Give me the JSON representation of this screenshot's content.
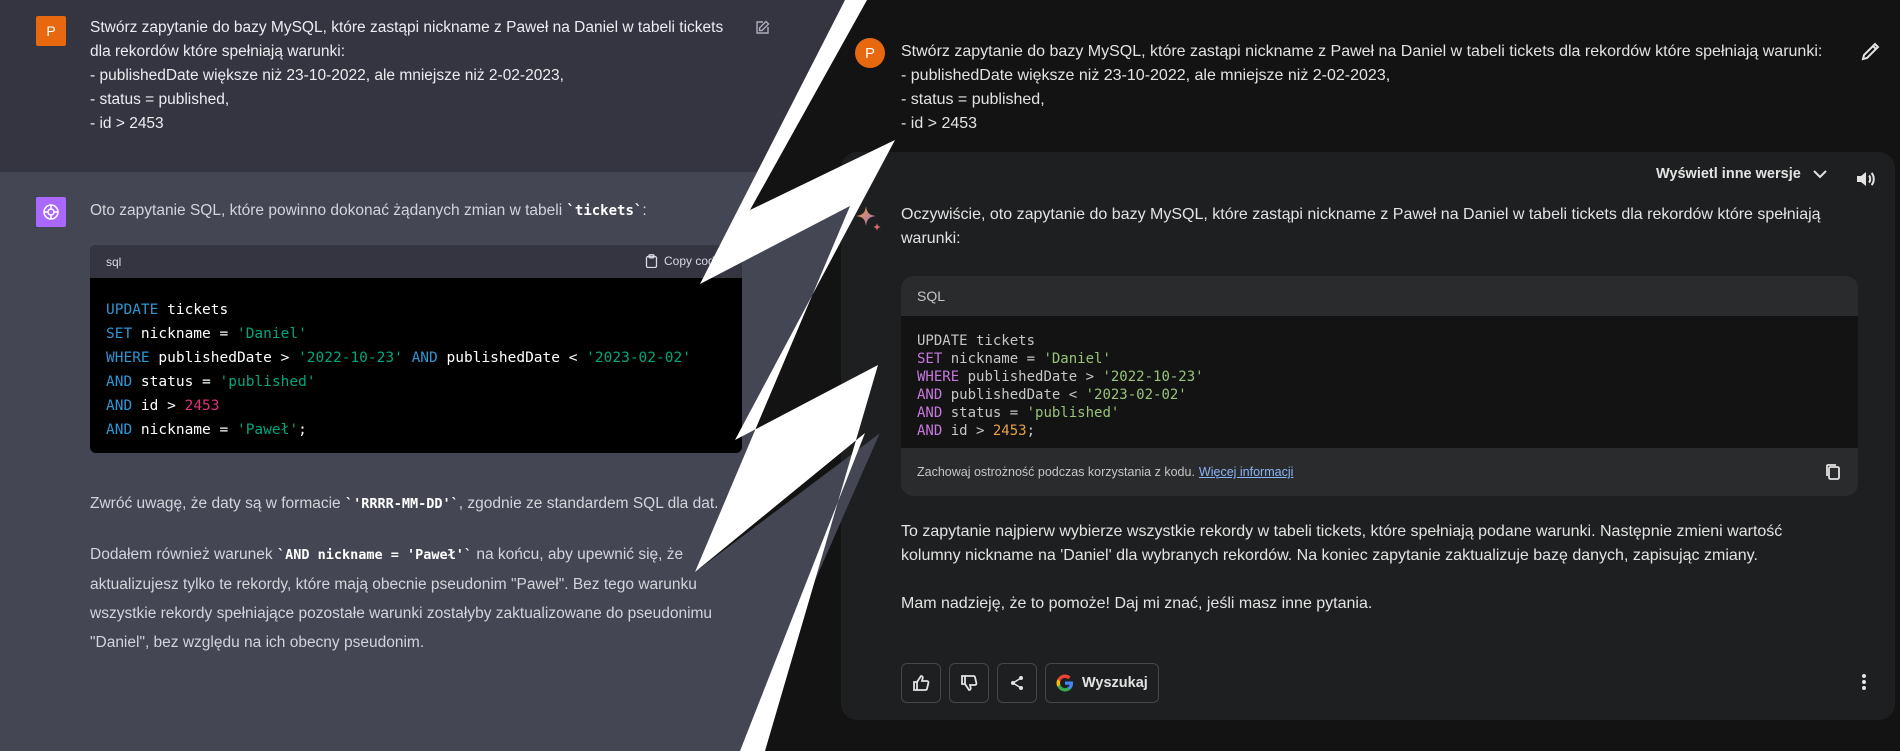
{
  "left": {
    "user": {
      "avatar_letter": "P",
      "line1": "Stwórz zapytanie do bazy MySQL, które zastąpi nickname z Paweł na Daniel w tabeli tickets",
      "line2": "dla rekordów które spełniają warunki:",
      "line3": "- publishedDate większe niż 23-10-2022, ale mniejsze niż 2-02-2023,",
      "line4": "- status = published,",
      "line5": "- id > 2453"
    },
    "assistant": {
      "intro_before": "Oto zapytanie SQL, które powinno dokonać żądanych zmian w tabeli ",
      "intro_code": "`tickets`",
      "intro_after": ":",
      "code_lang": "sql",
      "copy_label": "Copy code",
      "code": {
        "l1_k": "UPDATE",
        "l1_t": " tickets",
        "l2_k": "SET",
        "l2_t": " nickname = ",
        "l2_s": "'Daniel'",
        "l3_k": "WHERE",
        "l3_t1": " publishedDate > ",
        "l3_s1": "'2022-10-23'",
        "l3_k2": "AND",
        "l3_t2": " publishedDate < ",
        "l3_s2": "'2023-02-02'",
        "l4_k": "AND",
        "l4_t": " status = ",
        "l4_s": "'published'",
        "l5_k": "AND",
        "l5_t": " id > ",
        "l5_n": "2453",
        "l6_k": "AND",
        "l6_t": " nickname = ",
        "l6_s": "'Paweł'",
        "l6_end": ";"
      },
      "p1_before": "Zwróć uwagę, że daty są w formacie ",
      "p1_code": "`'RRRR-MM-DD'`",
      "p1_after": ", zgodnie ze standardem SQL dla dat.",
      "p2_before": "Dodałem również warunek ",
      "p2_code": "`AND nickname = 'Paweł'`",
      "p2_after": " na końcu, aby upewnić się, że",
      "p2_line2": "aktualizujesz tylko te rekordy, które mają obecnie pseudonim \"Paweł\". Bez tego warunku",
      "p2_line3": "wszystkie rekordy spełniające pozostałe warunki zostałyby zaktualizowane do pseudonimu",
      "p2_line4": "\"Daniel\", bez względu na ich obecny pseudonim."
    }
  },
  "right": {
    "user": {
      "avatar_letter": "P",
      "line1": "Stwórz zapytanie do bazy MySQL, które zastąpi nickname z Paweł na Daniel w tabeli tickets dla rekordów które spełniają warunki:",
      "line2": "- publishedDate większe niż 23-10-2022, ale mniejsze niż 2-02-2023,",
      "line3": "- status = published,",
      "line4": "- id > 2453"
    },
    "versions_label": "Wyświetl inne wersje",
    "intro_line1": "Oczywiście, oto zapytanie do bazy MySQL, które zastąpi nickname z Paweł na Daniel w tabeli tickets dla rekordów które spełniają",
    "intro_line2": "warunki:",
    "code_lang": "SQL",
    "code": {
      "l1": "UPDATE tickets",
      "l2_k": "SET",
      "l2_t": " nickname = ",
      "l2_s": "'Daniel'",
      "l3_k": "WHERE",
      "l3_t": " publishedDate > ",
      "l3_s": "'2022-10-23'",
      "l4_k": "AND",
      "l4_t": " publishedDate < ",
      "l4_s": "'2023-02-02'",
      "l5_k": "AND",
      "l5_t": " status = ",
      "l5_s": "'published'",
      "l6_k": "AND",
      "l6_t": " id > ",
      "l6_n": "2453",
      "l6_end": ";"
    },
    "caution_text": "Zachowaj ostrożność podczas korzystania z kodu.",
    "caution_link": "Więcej informacji",
    "p1_line1": "To zapytanie najpierw wybierze wszystkie rekordy w tabeli tickets, które spełniają podane warunki. Następnie zmieni wartość",
    "p1_line2": "kolumny nickname na 'Daniel' dla wybranych rekordów. Na koniec zapytanie zaktualizuje bazę danych, zapisując zmiany.",
    "p2": "Mam nadzieję, że to pomoże! Daj mi znać, jeśli masz inne pytania.",
    "search_label": "Wyszukaj"
  },
  "colors": {
    "chatgpt_user_bg": "#343541",
    "chatgpt_assistant_bg": "#444654",
    "bard_bg": "#131314",
    "bard_card_bg": "#1e1f20",
    "avatar_orange": "#e8680f",
    "gpt_purple": "#ab68ff"
  }
}
